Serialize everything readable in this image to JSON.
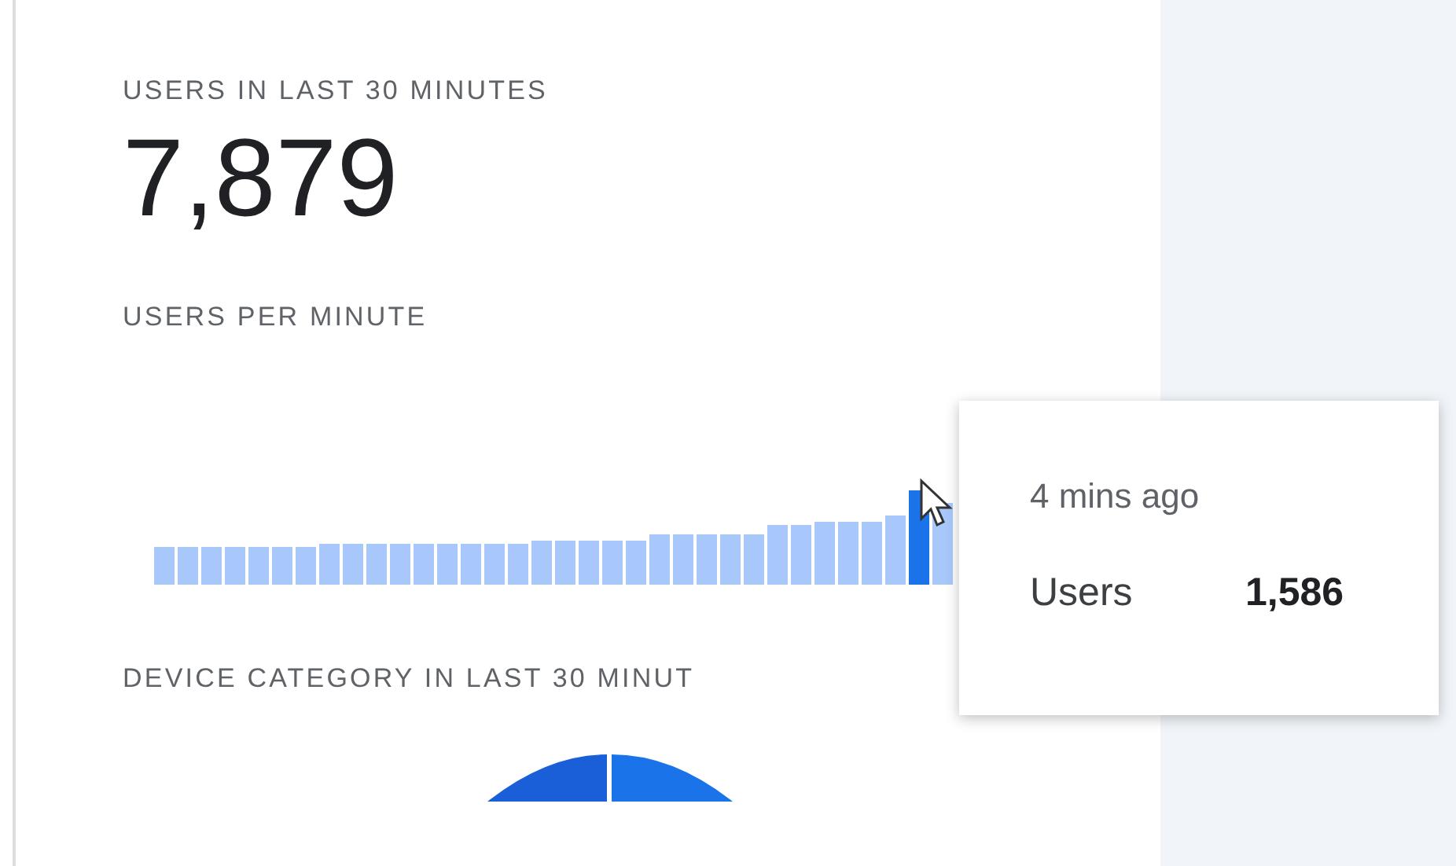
{
  "card": {
    "title": "USERS IN LAST 30 MINUTES",
    "total": "7,879",
    "chart_title": "USERS PER MINUTE",
    "device_title": "DEVICE CATEGORY IN LAST 30 MINUT"
  },
  "tooltip": {
    "time": "4 mins ago",
    "label": "Users",
    "value": "1,586"
  }
}
